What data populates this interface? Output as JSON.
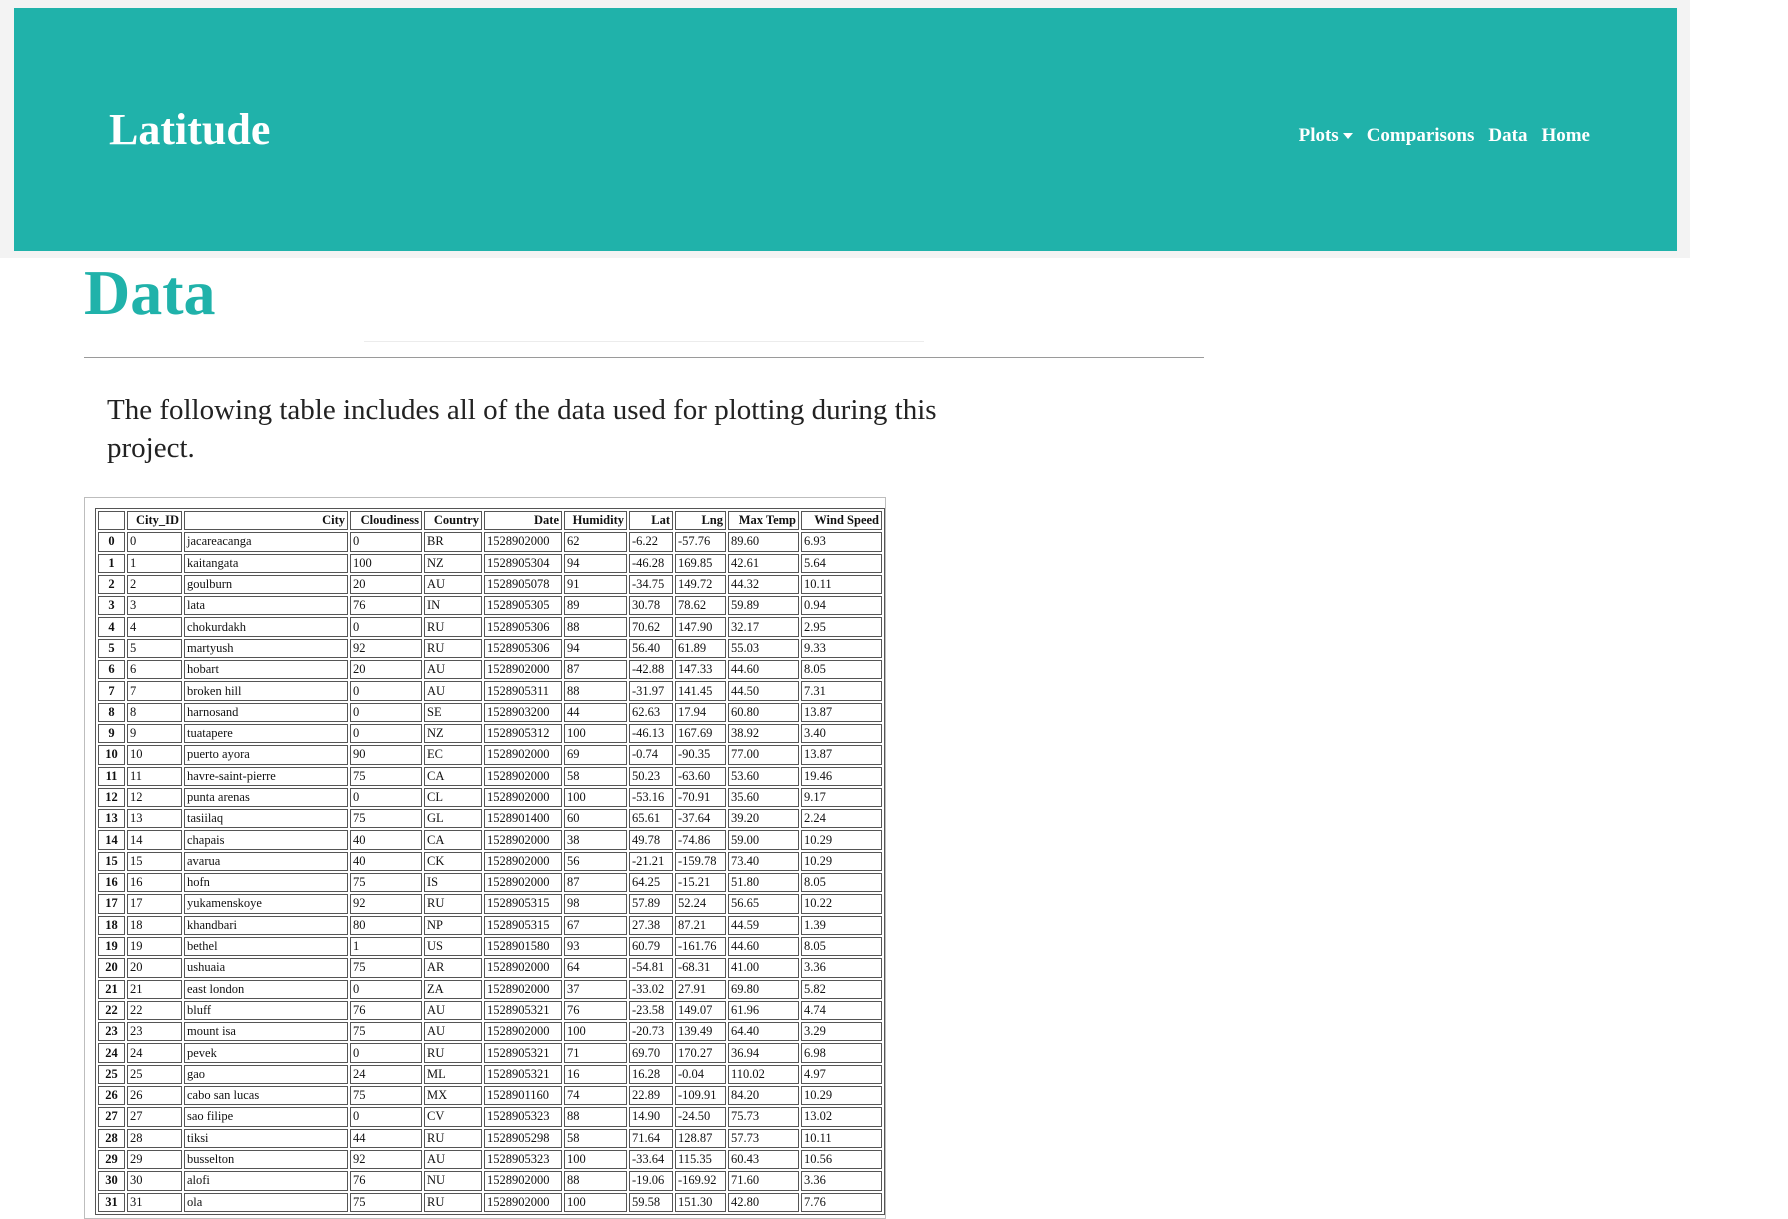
{
  "navbar": {
    "brand": "Latitude",
    "links": [
      {
        "label": "Plots",
        "dropdown": true
      },
      {
        "label": "Comparisons"
      },
      {
        "label": "Data"
      },
      {
        "label": "Home"
      }
    ],
    "accent_color": "#20b2aa"
  },
  "page": {
    "title": "Data",
    "intro": "The following table includes all of the data used for plotting during this project."
  },
  "table": {
    "columns": [
      "",
      "City_ID",
      "City",
      "Cloudiness",
      "Country",
      "Date",
      "Humidity",
      "Lat",
      "Lng",
      "Max Temp",
      "Wind Speed"
    ],
    "rows": [
      [
        "0",
        "0",
        "jacareacanga",
        "0",
        "BR",
        "1528902000",
        "62",
        "-6.22",
        "-57.76",
        "89.60",
        "6.93"
      ],
      [
        "1",
        "1",
        "kaitangata",
        "100",
        "NZ",
        "1528905304",
        "94",
        "-46.28",
        "169.85",
        "42.61",
        "5.64"
      ],
      [
        "2",
        "2",
        "goulburn",
        "20",
        "AU",
        "1528905078",
        "91",
        "-34.75",
        "149.72",
        "44.32",
        "10.11"
      ],
      [
        "3",
        "3",
        "lata",
        "76",
        "IN",
        "1528905305",
        "89",
        "30.78",
        "78.62",
        "59.89",
        "0.94"
      ],
      [
        "4",
        "4",
        "chokurdakh",
        "0",
        "RU",
        "1528905306",
        "88",
        "70.62",
        "147.90",
        "32.17",
        "2.95"
      ],
      [
        "5",
        "5",
        "martyush",
        "92",
        "RU",
        "1528905306",
        "94",
        "56.40",
        "61.89",
        "55.03",
        "9.33"
      ],
      [
        "6",
        "6",
        "hobart",
        "20",
        "AU",
        "1528902000",
        "87",
        "-42.88",
        "147.33",
        "44.60",
        "8.05"
      ],
      [
        "7",
        "7",
        "broken hill",
        "0",
        "AU",
        "1528905311",
        "88",
        "-31.97",
        "141.45",
        "44.50",
        "7.31"
      ],
      [
        "8",
        "8",
        "harnosand",
        "0",
        "SE",
        "1528903200",
        "44",
        "62.63",
        "17.94",
        "60.80",
        "13.87"
      ],
      [
        "9",
        "9",
        "tuatapere",
        "0",
        "NZ",
        "1528905312",
        "100",
        "-46.13",
        "167.69",
        "38.92",
        "3.40"
      ],
      [
        "10",
        "10",
        "puerto ayora",
        "90",
        "EC",
        "1528902000",
        "69",
        "-0.74",
        "-90.35",
        "77.00",
        "13.87"
      ],
      [
        "11",
        "11",
        "havre-saint-pierre",
        "75",
        "CA",
        "1528902000",
        "58",
        "50.23",
        "-63.60",
        "53.60",
        "19.46"
      ],
      [
        "12",
        "12",
        "punta arenas",
        "0",
        "CL",
        "1528902000",
        "100",
        "-53.16",
        "-70.91",
        "35.60",
        "9.17"
      ],
      [
        "13",
        "13",
        "tasiilaq",
        "75",
        "GL",
        "1528901400",
        "60",
        "65.61",
        "-37.64",
        "39.20",
        "2.24"
      ],
      [
        "14",
        "14",
        "chapais",
        "40",
        "CA",
        "1528902000",
        "38",
        "49.78",
        "-74.86",
        "59.00",
        "10.29"
      ],
      [
        "15",
        "15",
        "avarua",
        "40",
        "CK",
        "1528902000",
        "56",
        "-21.21",
        "-159.78",
        "73.40",
        "10.29"
      ],
      [
        "16",
        "16",
        "hofn",
        "75",
        "IS",
        "1528902000",
        "87",
        "64.25",
        "-15.21",
        "51.80",
        "8.05"
      ],
      [
        "17",
        "17",
        "yukamenskoye",
        "92",
        "RU",
        "1528905315",
        "98",
        "57.89",
        "52.24",
        "56.65",
        "10.22"
      ],
      [
        "18",
        "18",
        "khandbari",
        "80",
        "NP",
        "1528905315",
        "67",
        "27.38",
        "87.21",
        "44.59",
        "1.39"
      ],
      [
        "19",
        "19",
        "bethel",
        "1",
        "US",
        "1528901580",
        "93",
        "60.79",
        "-161.76",
        "44.60",
        "8.05"
      ],
      [
        "20",
        "20",
        "ushuaia",
        "75",
        "AR",
        "1528902000",
        "64",
        "-54.81",
        "-68.31",
        "41.00",
        "3.36"
      ],
      [
        "21",
        "21",
        "east london",
        "0",
        "ZA",
        "1528902000",
        "37",
        "-33.02",
        "27.91",
        "69.80",
        "5.82"
      ],
      [
        "22",
        "22",
        "bluff",
        "76",
        "AU",
        "1528905321",
        "76",
        "-23.58",
        "149.07",
        "61.96",
        "4.74"
      ],
      [
        "23",
        "23",
        "mount isa",
        "75",
        "AU",
        "1528902000",
        "100",
        "-20.73",
        "139.49",
        "64.40",
        "3.29"
      ],
      [
        "24",
        "24",
        "pevek",
        "0",
        "RU",
        "1528905321",
        "71",
        "69.70",
        "170.27",
        "36.94",
        "6.98"
      ],
      [
        "25",
        "25",
        "gao",
        "24",
        "ML",
        "1528905321",
        "16",
        "16.28",
        "-0.04",
        "110.02",
        "4.97"
      ],
      [
        "26",
        "26",
        "cabo san lucas",
        "75",
        "MX",
        "1528901160",
        "74",
        "22.89",
        "-109.91",
        "84.20",
        "10.29"
      ],
      [
        "27",
        "27",
        "sao filipe",
        "0",
        "CV",
        "1528905323",
        "88",
        "14.90",
        "-24.50",
        "75.73",
        "13.02"
      ],
      [
        "28",
        "28",
        "tiksi",
        "44",
        "RU",
        "1528905298",
        "58",
        "71.64",
        "128.87",
        "57.73",
        "10.11"
      ],
      [
        "29",
        "29",
        "busselton",
        "92",
        "AU",
        "1528905323",
        "100",
        "-33.64",
        "115.35",
        "60.43",
        "10.56"
      ],
      [
        "30",
        "30",
        "alofi",
        "76",
        "NU",
        "1528902000",
        "88",
        "-19.06",
        "-169.92",
        "71.60",
        "3.36"
      ],
      [
        "31",
        "31",
        "ola",
        "75",
        "RU",
        "1528902000",
        "100",
        "59.58",
        "151.30",
        "42.80",
        "7.76"
      ]
    ]
  }
}
